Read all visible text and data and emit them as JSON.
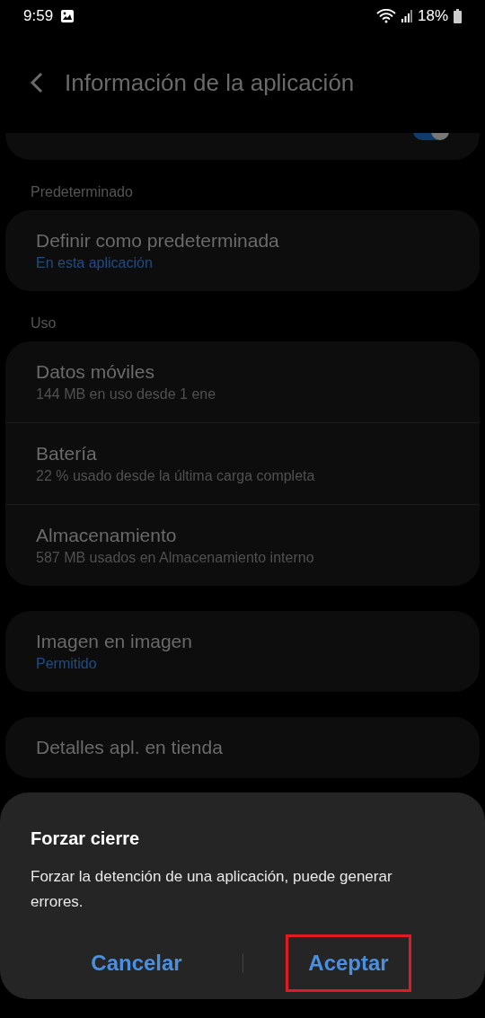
{
  "status_bar": {
    "time": "9:59",
    "battery": "18%"
  },
  "header": {
    "title": "Información de la aplicación"
  },
  "sections": [
    {
      "label": "Predeterminado",
      "items": [
        {
          "kind": "link",
          "title": "Definir como predeterminada",
          "subtitle": "En esta aplicación"
        }
      ]
    },
    {
      "label": "Uso",
      "items": [
        {
          "kind": "plain",
          "title": "Datos móviles",
          "subtitle": "144 MB en uso desde 1 ene"
        },
        {
          "kind": "plain",
          "title": "Batería",
          "subtitle": "22 % usado desde la última carga completa"
        },
        {
          "kind": "plain",
          "title": "Almacenamiento",
          "subtitle": "587 MB usados en Almacenamiento interno"
        }
      ]
    },
    {
      "items": [
        {
          "kind": "link",
          "title": "Imagen en imagen",
          "subtitle": "Permitido"
        }
      ]
    },
    {
      "items": [
        {
          "kind": "plain",
          "title": "Detalles apl. en tienda"
        }
      ]
    }
  ],
  "dialog": {
    "title": "Forzar cierre",
    "message": "Forzar la detención de una aplicación, puede generar errores.",
    "buttons": [
      {
        "label": "Cancelar",
        "highlighted": false
      },
      {
        "label": "Aceptar",
        "highlighted": true
      }
    ]
  }
}
